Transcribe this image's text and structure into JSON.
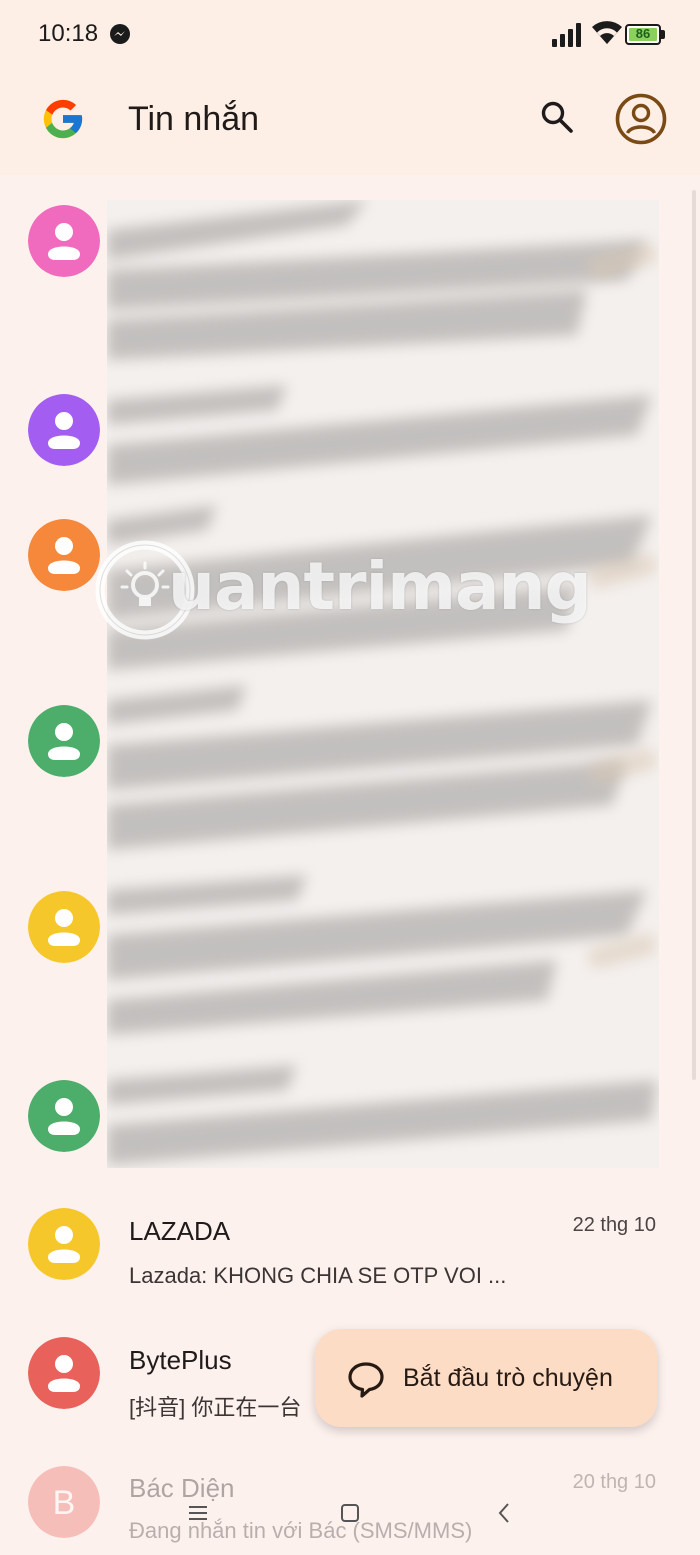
{
  "status_bar": {
    "time": "10:18",
    "battery": "86",
    "battery_level": 0.86,
    "icons": [
      "messenger-icon",
      "signal-icon",
      "wifi-icon",
      "battery-icon"
    ]
  },
  "app_bar": {
    "title": "Tin nhắn",
    "icons": [
      "google-logo",
      "search-icon",
      "account-icon"
    ]
  },
  "conversations": [
    {
      "name": "LAZADA",
      "date": "22 thg 10",
      "preview": "Lazada: KHONG CHIA SE OTP VOI ...",
      "avatar_color": "#f6c72b"
    },
    {
      "name": "BytePlus",
      "date": "",
      "preview": "[抖音] 你正在一台",
      "avatar_color": "#e8615a"
    },
    {
      "name": "Bác Diện",
      "date": "20 thg 10",
      "preview": "Đang nhắn tin với Bác (SMS/MMS)",
      "avatar_color": "#e8615a"
    }
  ],
  "blurred_avatar_colors": [
    "#f06bbd",
    "#a35df0",
    "#f5883b",
    "#4cae6a",
    "#f6c72b",
    "#4cae6a"
  ],
  "watermark": "uantrimang",
  "fab": {
    "label": "Bắt đầu trò chuyện",
    "icon": "chat-bubble-icon"
  },
  "nav": {
    "icons": [
      "menu-icon",
      "home-icon",
      "back-icon"
    ]
  }
}
